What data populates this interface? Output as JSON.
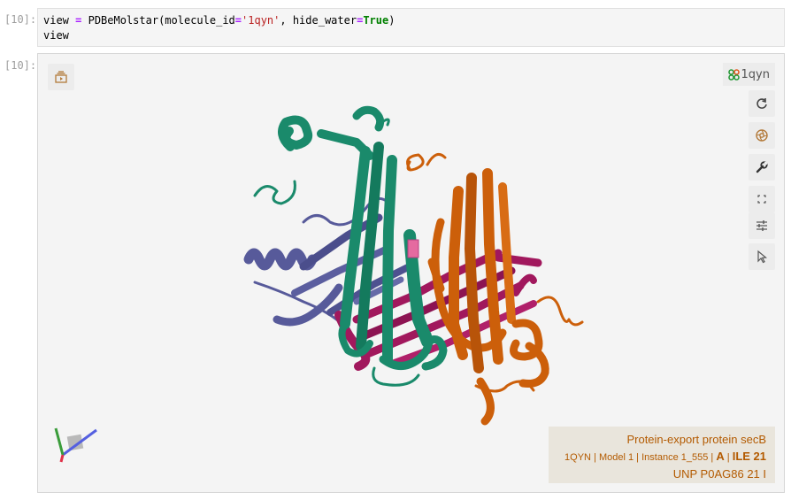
{
  "notebook": {
    "input_prompt": "[10]:",
    "output_prompt": "[10]:",
    "code": {
      "line1": {
        "var": "view",
        "eq": "=",
        "call": "PDBeMolstar(molecule_id",
        "eq2": "=",
        "string": "'1qyn'",
        "sep": ", hide_water",
        "eq3": "=",
        "kw": "True",
        "close": ")"
      },
      "line2": "view"
    }
  },
  "viewer": {
    "molecule_badge": "1qyn",
    "info": {
      "title": "Protein-export protein secB",
      "pdb": "1QYN",
      "model": "Model 1",
      "instance": "Instance 1_555",
      "chain": "A",
      "residue": "ILE 21",
      "unp": "UNP P0AG86 21 I"
    },
    "toolbar_icons": [
      "reset-icon",
      "screenshot-icon",
      "wrench-icon",
      "fullscreen-icon",
      "settings-sliders-icon",
      "select-cursor-icon"
    ],
    "chain_colors": {
      "chain_a": "#1a8a6b",
      "chain_b": "#cc5f0a",
      "chain_c": "#a1185d",
      "chain_d": "#575a9a"
    }
  }
}
